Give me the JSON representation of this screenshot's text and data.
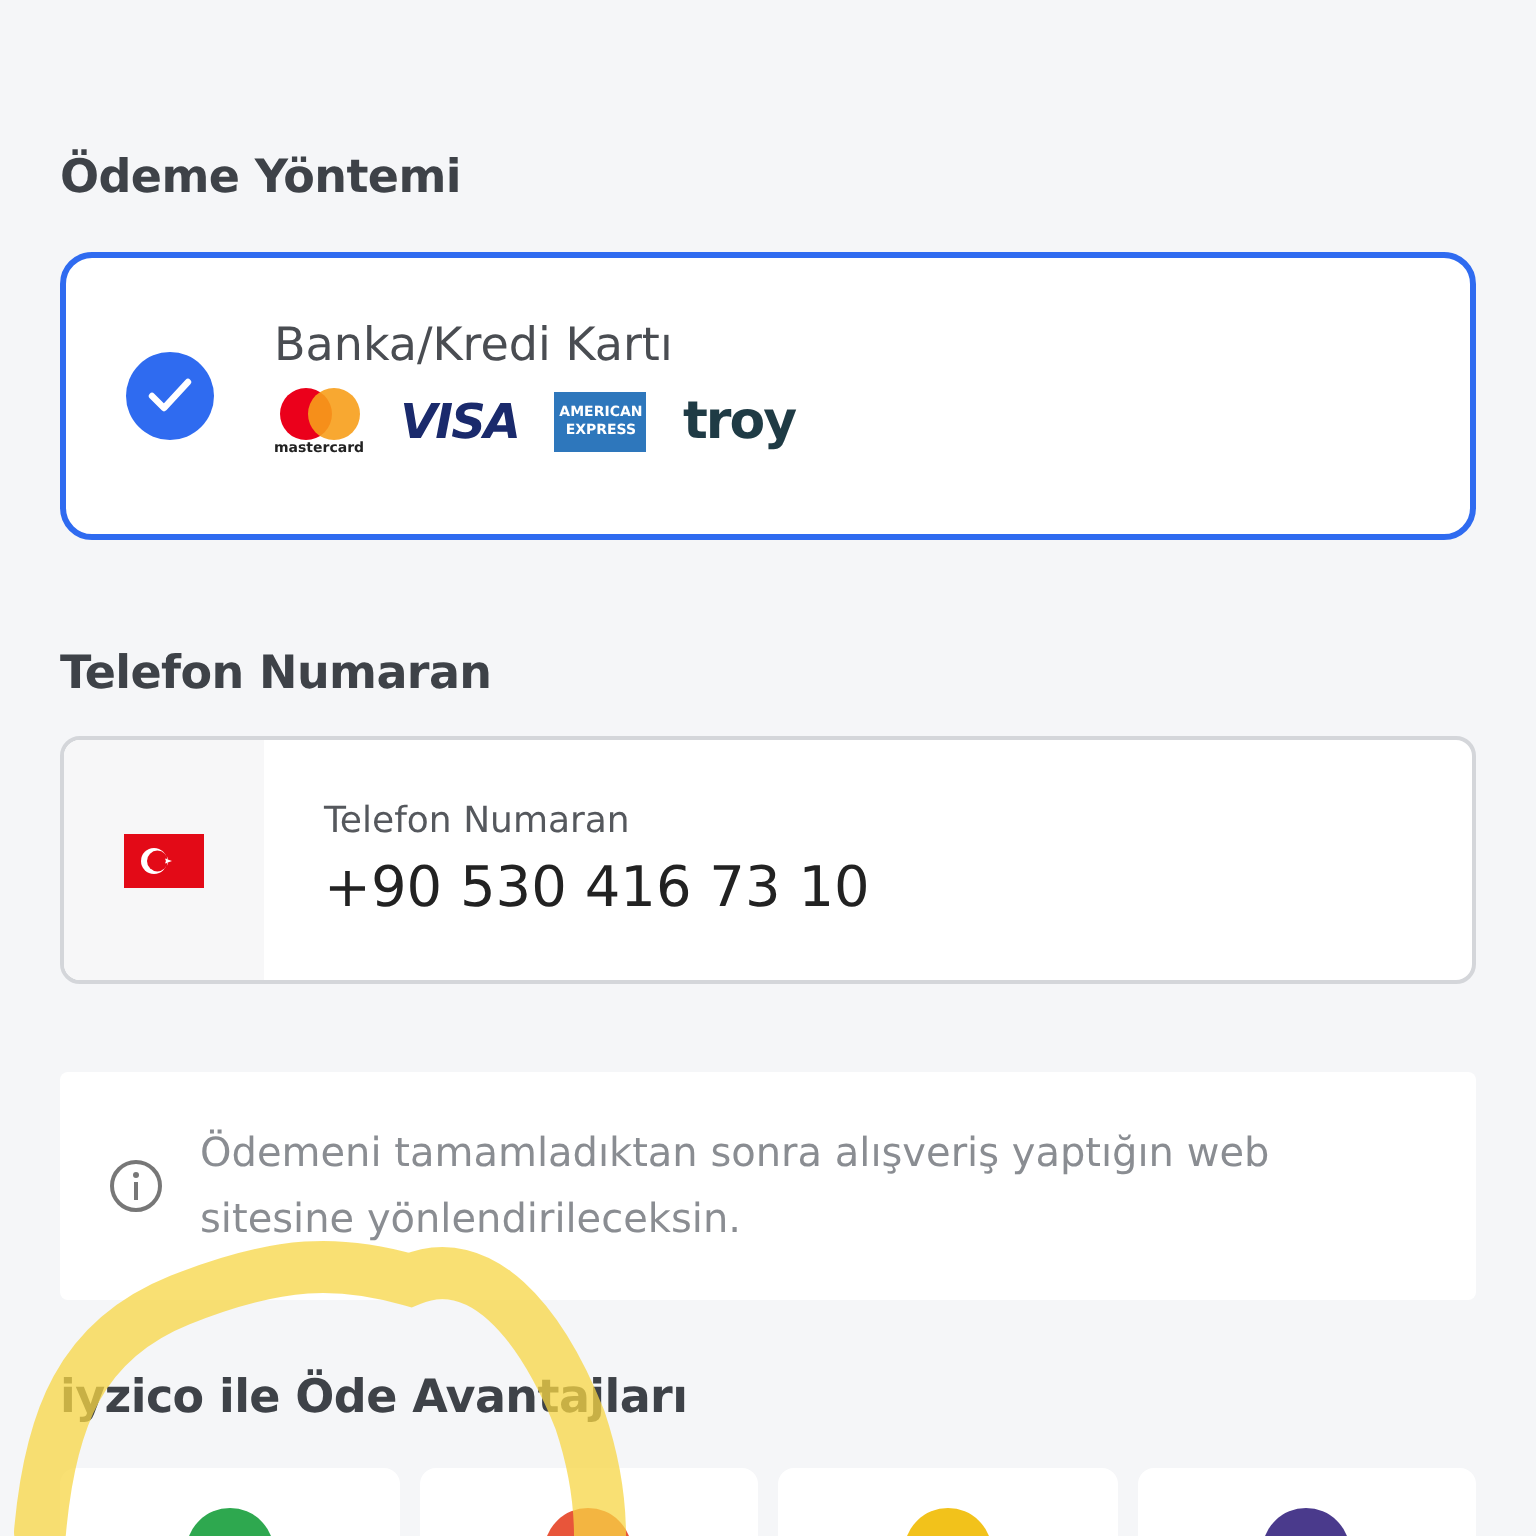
{
  "payment_method": {
    "title": "Ödeme Yöntemi",
    "options": [
      {
        "label": "Banka/Kredi Kartı",
        "selected": true,
        "logos": [
          {
            "kind": "mastercard",
            "text": "mastercard"
          },
          {
            "kind": "visa",
            "text": "VISA"
          },
          {
            "kind": "amex",
            "text": "AMERICAN EXPRESS"
          },
          {
            "kind": "troy",
            "text": "troy"
          }
        ]
      }
    ]
  },
  "phone": {
    "title": "Telefon Numaran",
    "label": "Telefon Numaran",
    "value": "+90 530 416 73 10"
  },
  "info": {
    "text": "Ödemeni tamamladıktan sonra alışveriş yaptığın web sitesine yönlendirileceksin."
  },
  "advantages": {
    "title": "iyzico ile Öde Avantajları",
    "cards": [
      {
        "color": "#2ea84f"
      },
      {
        "color": "#e8553a"
      },
      {
        "color": "#f2c21b"
      },
      {
        "color": "#4a3a8c"
      }
    ]
  }
}
